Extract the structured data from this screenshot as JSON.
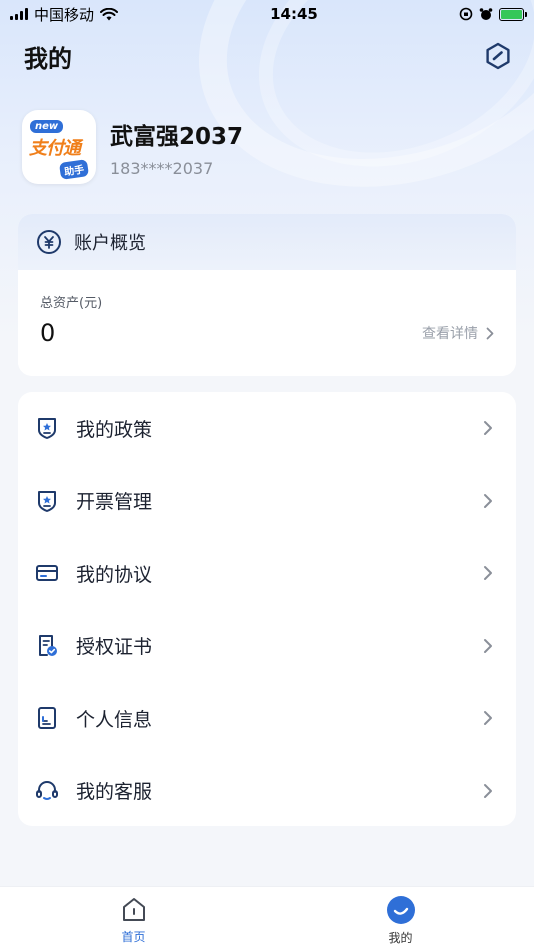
{
  "status_bar": {
    "carrier": "中国移动",
    "time": "14:45"
  },
  "header": {
    "title": "我的"
  },
  "profile": {
    "name": "武富强2037",
    "phone": "183****2037",
    "avatar_badge": "new",
    "avatar_text": "支付通",
    "avatar_sub": "助手"
  },
  "account": {
    "title": "账户概览",
    "asset_label": "总资产(元)",
    "asset_value": "0",
    "detail_link": "查看详情"
  },
  "menu": [
    {
      "label": "我的政策",
      "icon": "shield-star-icon"
    },
    {
      "label": "开票管理",
      "icon": "shield-star-icon"
    },
    {
      "label": "我的协议",
      "icon": "card-icon"
    },
    {
      "label": "授权证书",
      "icon": "certificate-icon"
    },
    {
      "label": "个人信息",
      "icon": "document-icon"
    },
    {
      "label": "我的客服",
      "icon": "headset-icon"
    }
  ],
  "tabs": [
    {
      "label": "首页",
      "icon": "home-icon",
      "active": false
    },
    {
      "label": "我的",
      "icon": "mine-icon",
      "active": true
    }
  ],
  "colors": {
    "accent": "#2f6fd7",
    "icon": "#1f3a6b",
    "battery": "#35c759"
  }
}
